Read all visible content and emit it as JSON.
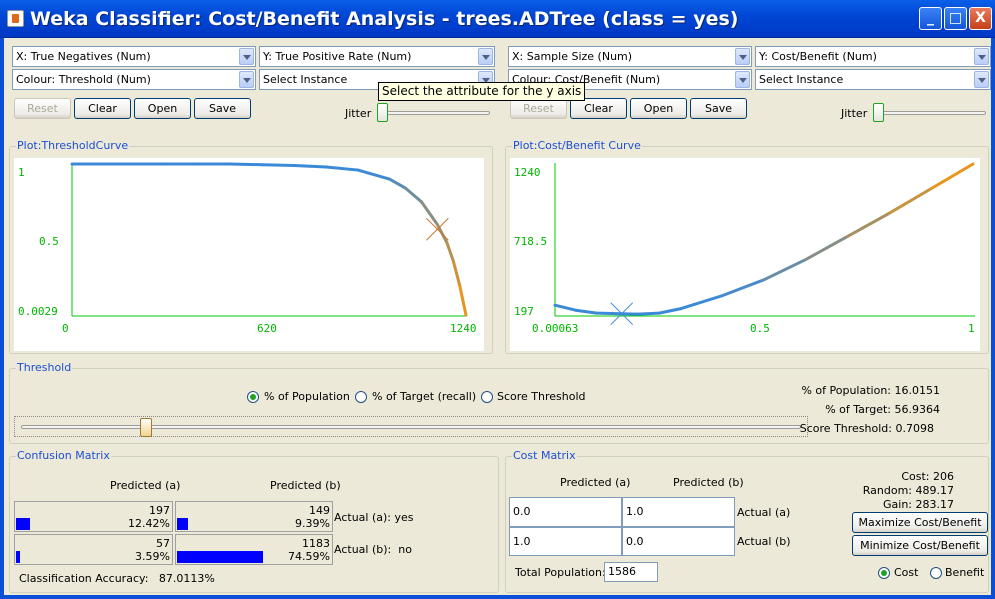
{
  "window": {
    "title": "Weka Classifier: Cost/Benefit Analysis - trees.ADTree (class = yes)",
    "minimize": "_",
    "maximize": "□",
    "close": "X"
  },
  "left": {
    "x_axis": "X: True Negatives (Num)",
    "y_axis": "Y: True Positive Rate (Num)",
    "colour": "Colour: Threshold (Num)",
    "select_instance": "Select Instance",
    "reset": "Reset",
    "clear": "Clear",
    "open": "Open",
    "save": "Save",
    "jitter": "Jitter",
    "plot_title": "Plot:ThresholdCurve"
  },
  "right": {
    "x_axis": "X: Sample Size (Num)",
    "y_axis": "Y: Cost/Benefit (Num)",
    "colour": "Colour: Cost/Benefit (Num)",
    "select_instance": "Select Instance",
    "reset": "Reset",
    "clear": "Clear",
    "open": "Open",
    "save": "Save",
    "jitter": "Jitter",
    "plot_title": "Plot:Cost/Benefit Curve"
  },
  "tooltip": "Select the attribute for the y axis",
  "chart_data": [
    {
      "type": "line",
      "x": [
        0,
        100,
        200,
        300,
        400,
        500,
        600,
        700,
        800,
        900,
        1000,
        1050,
        1100,
        1150,
        1180,
        1200,
        1220,
        1240
      ],
      "y": [
        1,
        1,
        1,
        1,
        1,
        1,
        0.995,
        0.99,
        0.98,
        0.96,
        0.9,
        0.84,
        0.75,
        0.6,
        0.48,
        0.36,
        0.2,
        0.0029
      ],
      "xlim": [
        0,
        1240
      ],
      "ylim": [
        0.0029,
        1
      ],
      "x_ticks": [
        "0",
        "620",
        "1240"
      ],
      "y_ticks": [
        "1",
        "0.5",
        "0.0029"
      ],
      "marker": {
        "x": 1150,
        "y": 0.5693
      },
      "colors": [
        "#3a8ad8",
        "#e6951e"
      ]
    },
    {
      "type": "line",
      "x": [
        0.00063,
        0.05,
        0.1,
        0.16,
        0.2,
        0.25,
        0.3,
        0.4,
        0.5,
        0.6,
        0.7,
        0.8,
        0.9,
        1
      ],
      "y": [
        265,
        230,
        210,
        206,
        203,
        210,
        240,
        330,
        440,
        580,
        740,
        900,
        1070,
        1240
      ],
      "xlim": [
        0.00063,
        1
      ],
      "ylim": [
        197,
        1240
      ],
      "x_ticks": [
        "0.00063",
        "0.5",
        "1"
      ],
      "y_ticks": [
        "1240",
        "718.5",
        "197"
      ],
      "marker": {
        "x": 0.1602,
        "y": 206
      },
      "colors": [
        "#3a8ad8",
        "#e6951e"
      ]
    }
  ],
  "threshold": {
    "title": "Threshold",
    "options": [
      "% of Population",
      "% of Target (recall)",
      "Score Threshold"
    ],
    "selected": 0,
    "slider_value": 0.160151,
    "stats": [
      {
        "label": "% of Population:",
        "value": "16.0151"
      },
      {
        "label": "% of Target:",
        "value": "56.9364"
      },
      {
        "label": "Score Threshold:",
        "value": "0.7098"
      }
    ]
  },
  "confusion": {
    "title": "Confusion Matrix",
    "pred_a": "Predicted (a)",
    "pred_b": "Predicted (b)",
    "cells": [
      {
        "count": "197",
        "pct": "12.42%",
        "fill": 0.1242
      },
      {
        "count": "149",
        "pct": "9.39%",
        "fill": 0.0939
      },
      {
        "count": "57",
        "pct": "3.59%",
        "fill": 0.0359
      },
      {
        "count": "1183",
        "pct": "74.59%",
        "fill": 0.7459
      }
    ],
    "actual_a": "Actual (a): yes",
    "actual_b": "Actual (b):  no",
    "accuracy": "Classification Accuracy:   87.0113%"
  },
  "cost": {
    "title": "Cost Matrix",
    "pred_a": "Predicted (a)",
    "pred_b": "Predicted (b)",
    "cells": [
      "0.0",
      "1.0",
      "1.0",
      "0.0"
    ],
    "actual_a": "Actual (a)",
    "actual_b": "Actual (b)",
    "total_label": "Total Population:",
    "total_value": "1586",
    "cost_line": "Cost: 206",
    "random_line": "Random: 489.17",
    "gain_line": "Gain: 283.17",
    "maximize": "Maximize Cost/Benefit",
    "minimize": "Minimize Cost/Benefit",
    "mode_options": [
      "Cost",
      "Benefit"
    ],
    "mode_selected": 0
  }
}
